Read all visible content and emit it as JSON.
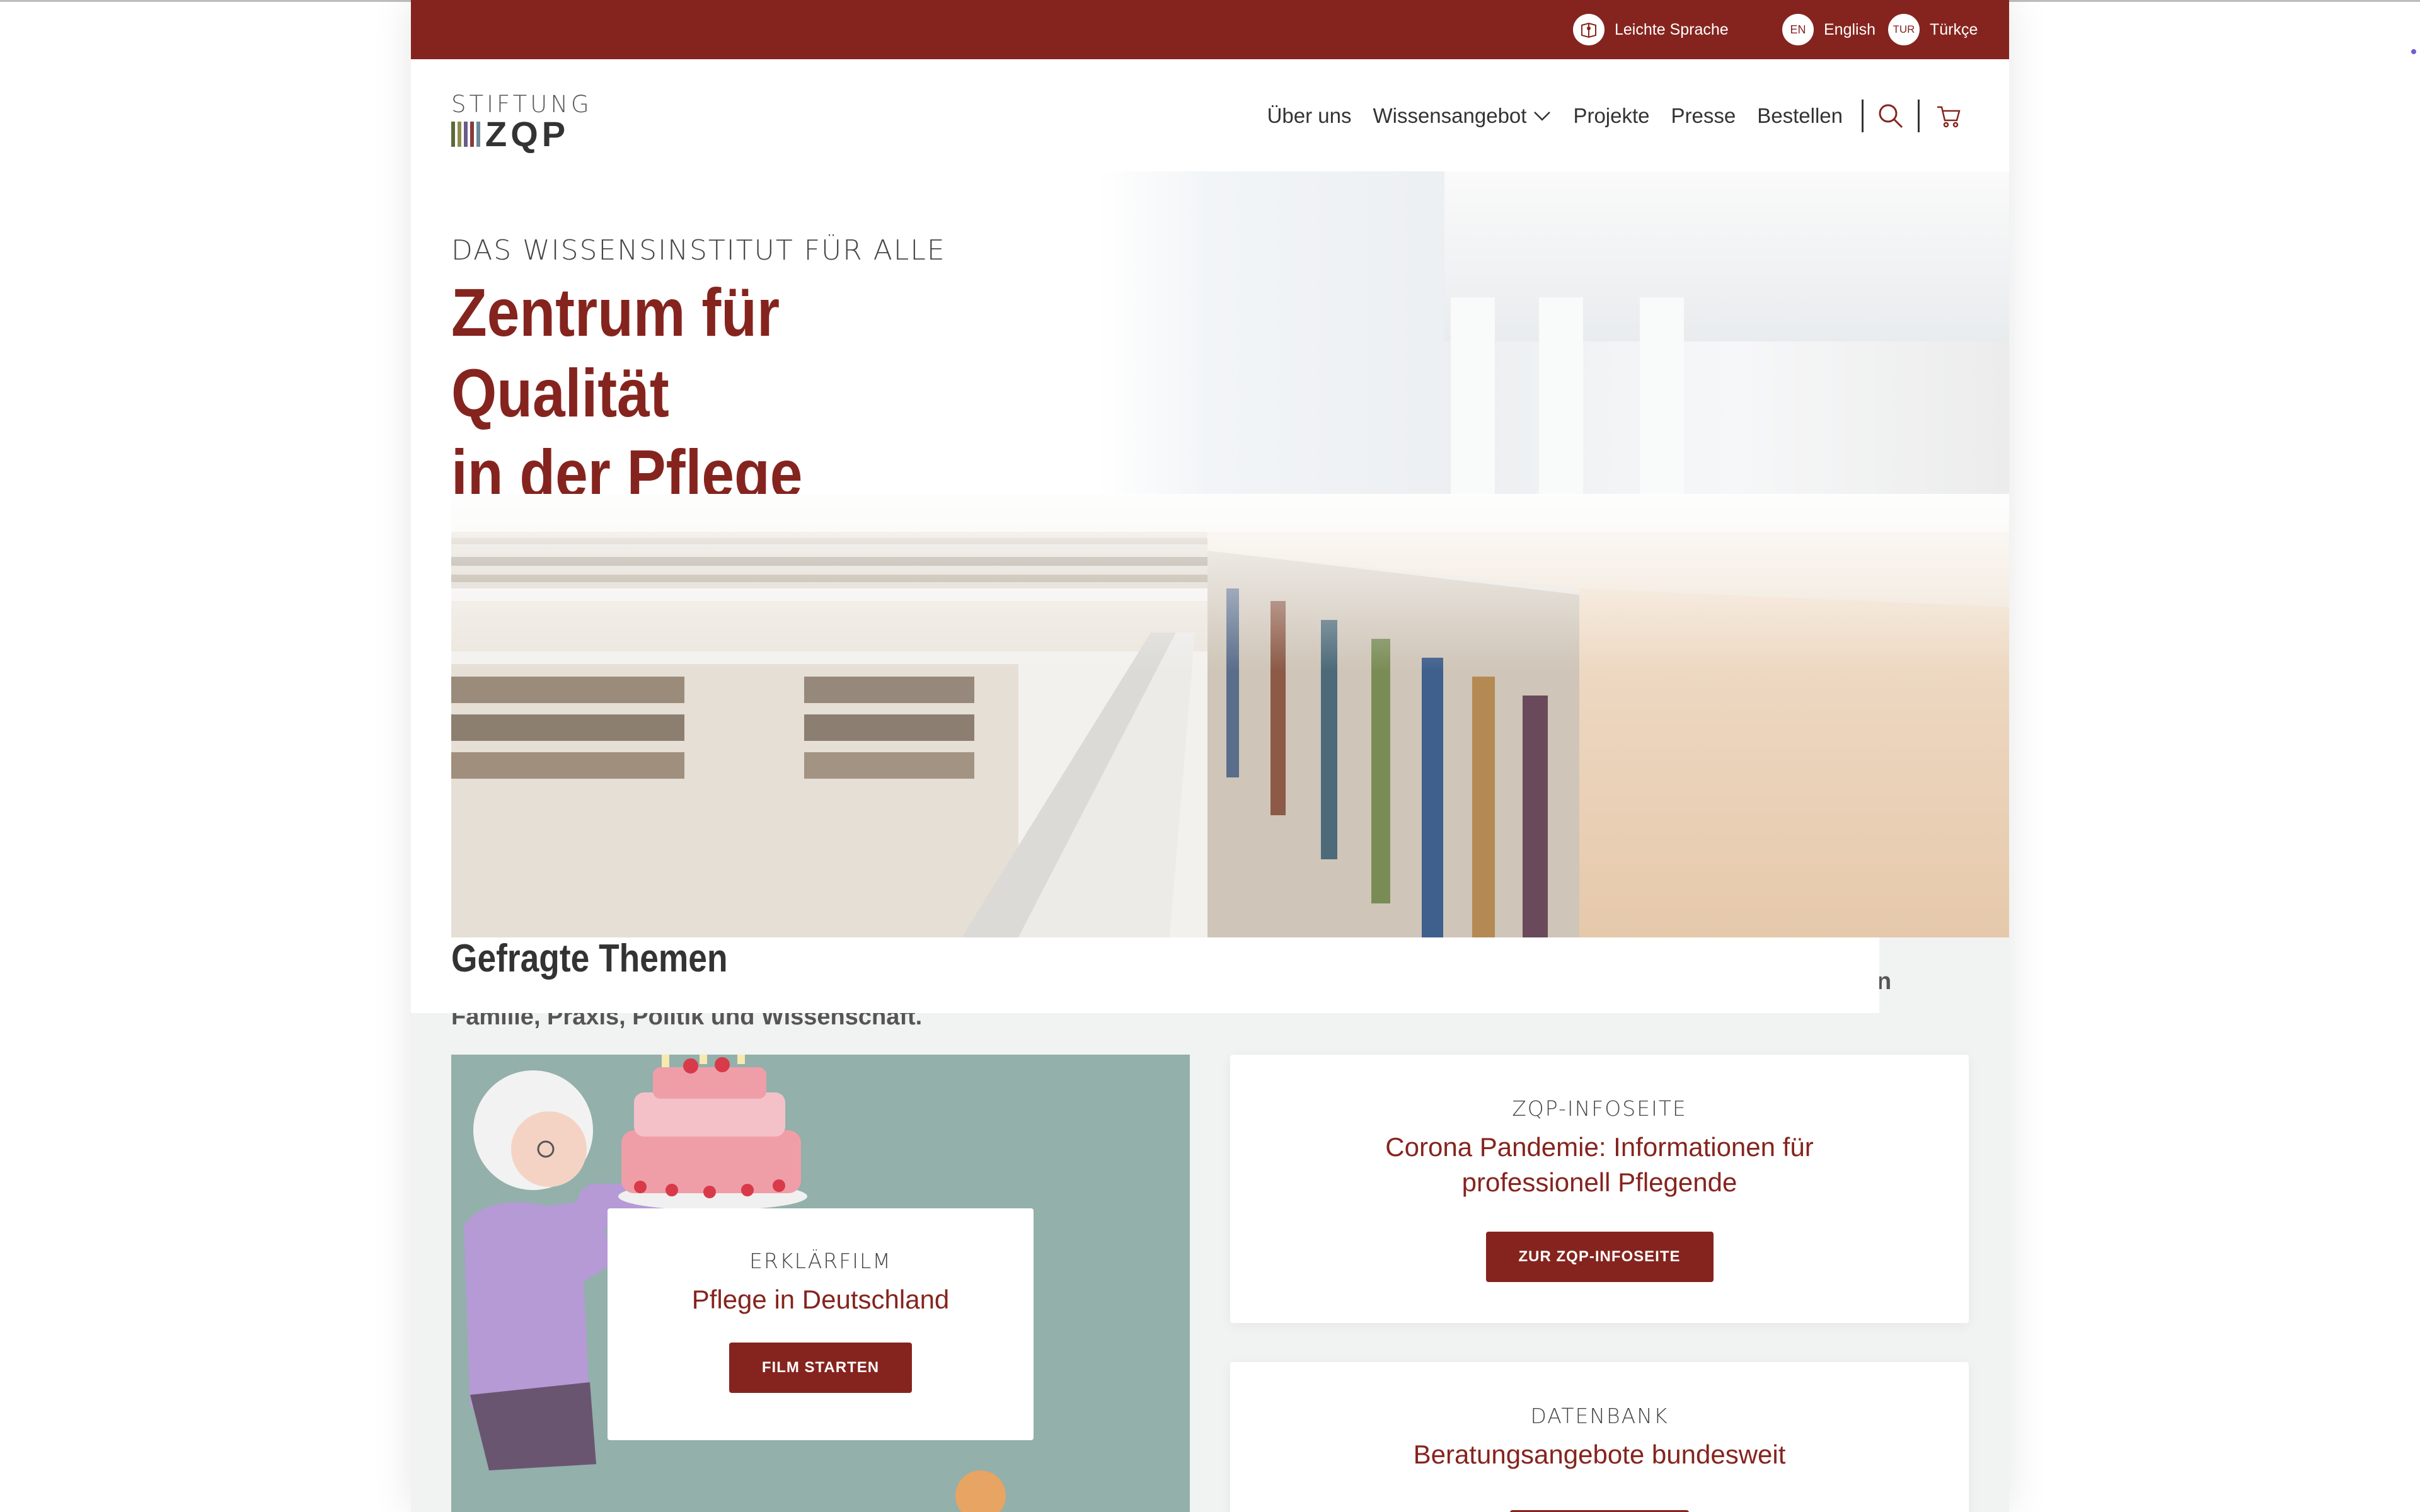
{
  "utility": {
    "items": [
      {
        "label": "Leichte Sprache",
        "icon": "book-icon"
      },
      {
        "label": "English",
        "badge": "EN"
      },
      {
        "label": "Türkçe",
        "badge": "TUR"
      }
    ]
  },
  "logo": {
    "top": "STIFTUNG",
    "bottom": "ZQP"
  },
  "nav": {
    "items": [
      "Über uns",
      "Wissensangebot",
      "Projekte",
      "Presse",
      "Bestellen"
    ],
    "icons": [
      "search-icon",
      "cart-icon"
    ]
  },
  "hero": {
    "kicker": "DAS WISSENSINSTITUT FÜR ALLE",
    "title_line1": "Zentrum für Qualität",
    "title_line2": "in der Pflege",
    "intro": "Als gemeinnützige Stiftung unterstützen wir mit unserem Angebot alle, die sich für pflegebedürftige Menschen engagieren – in Familie, Praxis, Politik und Wissenschaft."
  },
  "themes": {
    "title": "Gefragte Themen",
    "film": {
      "label": "ERKLÄRFILM",
      "title": "Pflege in Deutschland",
      "button": "FILM STARTEN"
    },
    "info": {
      "label": "ZQP-INFOSEITE",
      "title": "Corona Pandemie: Informationen für professionell Pflegende",
      "button": "ZUR ZQP-INFOSEITE"
    },
    "database": {
      "label": "DATENBANK",
      "title": "Beratungsangebote bundesweit"
    }
  },
  "colors": {
    "brand": "#85241e",
    "card_bg": "#93b0ab",
    "page_bg": "#f1f2f2"
  }
}
